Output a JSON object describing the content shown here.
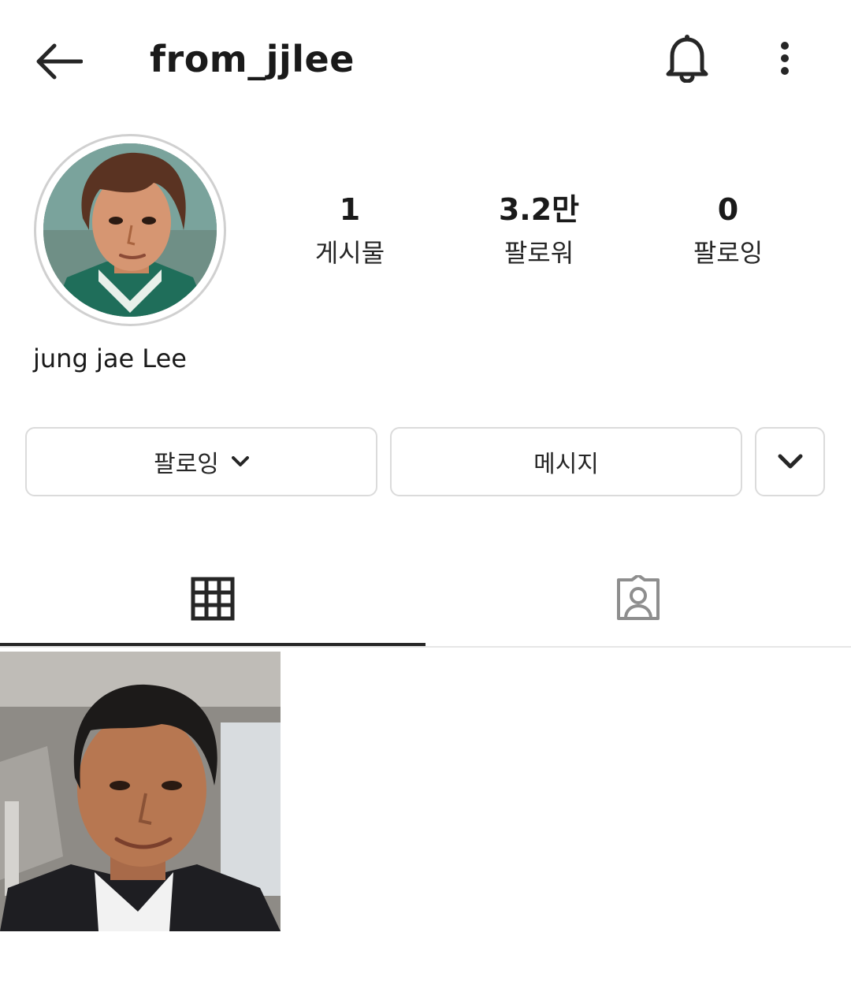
{
  "header": {
    "username": "from_jjlee",
    "back_icon": "arrow-left-icon",
    "bell_icon": "bell-icon",
    "more_icon": "more-vertical-icon"
  },
  "profile": {
    "display_name": "jung jae Lee",
    "stats": [
      {
        "value": "1",
        "label": "게시물"
      },
      {
        "value": "3.2만",
        "label": "팔로워"
      },
      {
        "value": "0",
        "label": "팔로잉"
      }
    ]
  },
  "actions": {
    "following_label": "팔로잉",
    "message_label": "메시지"
  },
  "tabs": {
    "grid_icon": "grid-icon",
    "tagged_icon": "tagged-person-icon",
    "active": "grid"
  },
  "colors": {
    "text": "#262626",
    "border": "#dbdbdb",
    "indicator": "#262626"
  }
}
